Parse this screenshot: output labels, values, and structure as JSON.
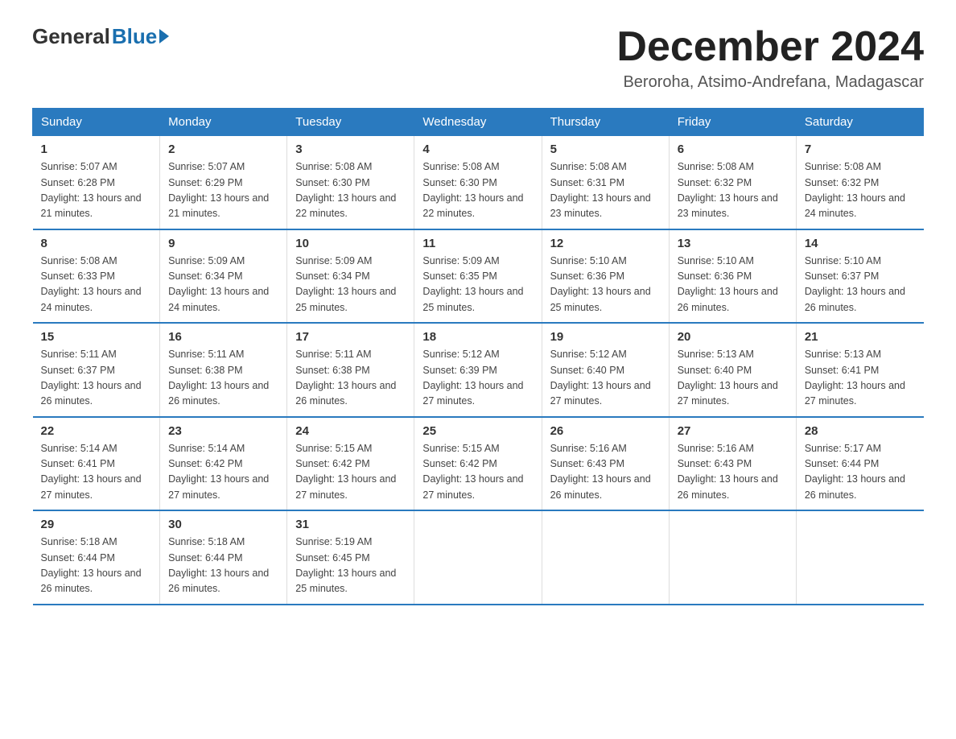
{
  "header": {
    "logo_general": "General",
    "logo_blue": "Blue",
    "month_title": "December 2024",
    "location": "Beroroha, Atsimo-Andrefana, Madagascar"
  },
  "calendar": {
    "days_of_week": [
      "Sunday",
      "Monday",
      "Tuesday",
      "Wednesday",
      "Thursday",
      "Friday",
      "Saturday"
    ],
    "weeks": [
      [
        {
          "day": "1",
          "sunrise": "5:07 AM",
          "sunset": "6:28 PM",
          "daylight": "13 hours and 21 minutes."
        },
        {
          "day": "2",
          "sunrise": "5:07 AM",
          "sunset": "6:29 PM",
          "daylight": "13 hours and 21 minutes."
        },
        {
          "day": "3",
          "sunrise": "5:08 AM",
          "sunset": "6:30 PM",
          "daylight": "13 hours and 22 minutes."
        },
        {
          "day": "4",
          "sunrise": "5:08 AM",
          "sunset": "6:30 PM",
          "daylight": "13 hours and 22 minutes."
        },
        {
          "day": "5",
          "sunrise": "5:08 AM",
          "sunset": "6:31 PM",
          "daylight": "13 hours and 23 minutes."
        },
        {
          "day": "6",
          "sunrise": "5:08 AM",
          "sunset": "6:32 PM",
          "daylight": "13 hours and 23 minutes."
        },
        {
          "day": "7",
          "sunrise": "5:08 AM",
          "sunset": "6:32 PM",
          "daylight": "13 hours and 24 minutes."
        }
      ],
      [
        {
          "day": "8",
          "sunrise": "5:08 AM",
          "sunset": "6:33 PM",
          "daylight": "13 hours and 24 minutes."
        },
        {
          "day": "9",
          "sunrise": "5:09 AM",
          "sunset": "6:34 PM",
          "daylight": "13 hours and 24 minutes."
        },
        {
          "day": "10",
          "sunrise": "5:09 AM",
          "sunset": "6:34 PM",
          "daylight": "13 hours and 25 minutes."
        },
        {
          "day": "11",
          "sunrise": "5:09 AM",
          "sunset": "6:35 PM",
          "daylight": "13 hours and 25 minutes."
        },
        {
          "day": "12",
          "sunrise": "5:10 AM",
          "sunset": "6:36 PM",
          "daylight": "13 hours and 25 minutes."
        },
        {
          "day": "13",
          "sunrise": "5:10 AM",
          "sunset": "6:36 PM",
          "daylight": "13 hours and 26 minutes."
        },
        {
          "day": "14",
          "sunrise": "5:10 AM",
          "sunset": "6:37 PM",
          "daylight": "13 hours and 26 minutes."
        }
      ],
      [
        {
          "day": "15",
          "sunrise": "5:11 AM",
          "sunset": "6:37 PM",
          "daylight": "13 hours and 26 minutes."
        },
        {
          "day": "16",
          "sunrise": "5:11 AM",
          "sunset": "6:38 PM",
          "daylight": "13 hours and 26 minutes."
        },
        {
          "day": "17",
          "sunrise": "5:11 AM",
          "sunset": "6:38 PM",
          "daylight": "13 hours and 26 minutes."
        },
        {
          "day": "18",
          "sunrise": "5:12 AM",
          "sunset": "6:39 PM",
          "daylight": "13 hours and 27 minutes."
        },
        {
          "day": "19",
          "sunrise": "5:12 AM",
          "sunset": "6:40 PM",
          "daylight": "13 hours and 27 minutes."
        },
        {
          "day": "20",
          "sunrise": "5:13 AM",
          "sunset": "6:40 PM",
          "daylight": "13 hours and 27 minutes."
        },
        {
          "day": "21",
          "sunrise": "5:13 AM",
          "sunset": "6:41 PM",
          "daylight": "13 hours and 27 minutes."
        }
      ],
      [
        {
          "day": "22",
          "sunrise": "5:14 AM",
          "sunset": "6:41 PM",
          "daylight": "13 hours and 27 minutes."
        },
        {
          "day": "23",
          "sunrise": "5:14 AM",
          "sunset": "6:42 PM",
          "daylight": "13 hours and 27 minutes."
        },
        {
          "day": "24",
          "sunrise": "5:15 AM",
          "sunset": "6:42 PM",
          "daylight": "13 hours and 27 minutes."
        },
        {
          "day": "25",
          "sunrise": "5:15 AM",
          "sunset": "6:42 PM",
          "daylight": "13 hours and 27 minutes."
        },
        {
          "day": "26",
          "sunrise": "5:16 AM",
          "sunset": "6:43 PM",
          "daylight": "13 hours and 26 minutes."
        },
        {
          "day": "27",
          "sunrise": "5:16 AM",
          "sunset": "6:43 PM",
          "daylight": "13 hours and 26 minutes."
        },
        {
          "day": "28",
          "sunrise": "5:17 AM",
          "sunset": "6:44 PM",
          "daylight": "13 hours and 26 minutes."
        }
      ],
      [
        {
          "day": "29",
          "sunrise": "5:18 AM",
          "sunset": "6:44 PM",
          "daylight": "13 hours and 26 minutes."
        },
        {
          "day": "30",
          "sunrise": "5:18 AM",
          "sunset": "6:44 PM",
          "daylight": "13 hours and 26 minutes."
        },
        {
          "day": "31",
          "sunrise": "5:19 AM",
          "sunset": "6:45 PM",
          "daylight": "13 hours and 25 minutes."
        },
        null,
        null,
        null,
        null
      ]
    ]
  }
}
